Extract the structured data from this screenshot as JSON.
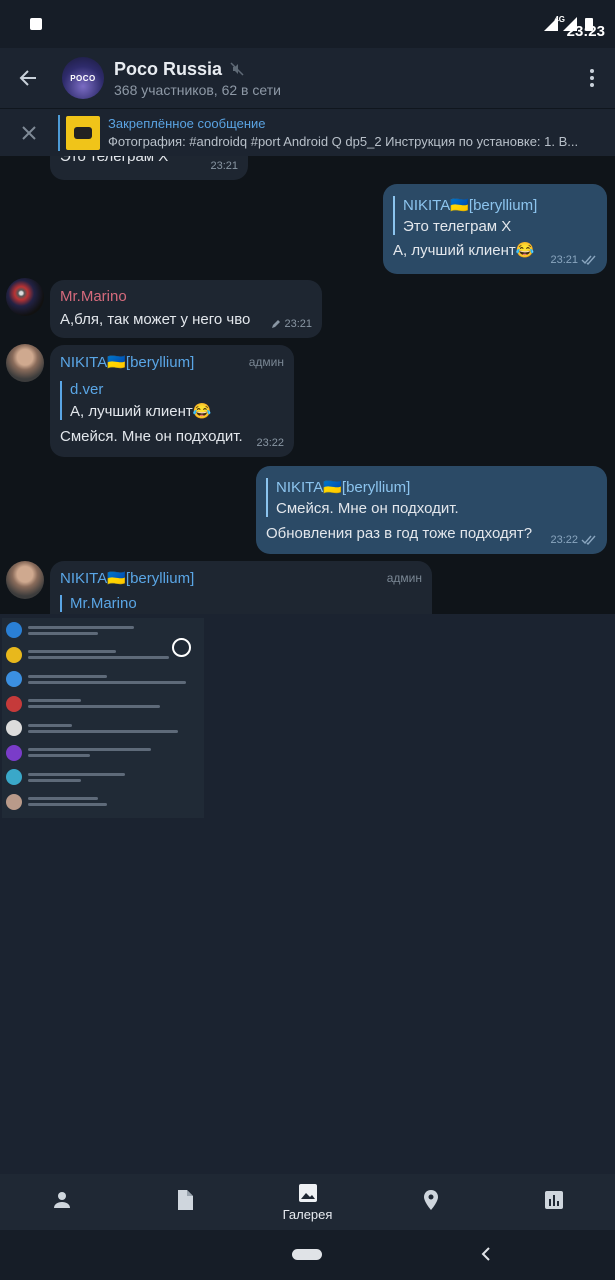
{
  "status_bar": {
    "time": "23:23",
    "network": "4G"
  },
  "header": {
    "title": "Poco Russia",
    "subtitle": "368 участников, 62 в сети",
    "avatar_text": "POCO"
  },
  "pinned": {
    "title": "Закреплённое сообщение",
    "text": "Фотография: #androidq #port Android Q dp5_2  Инструкция по установке: 1. В..."
  },
  "messages": [
    {
      "text": "Это телеграм X",
      "time": "23:21"
    },
    {
      "quote_name": "NIKITA🇺🇦[beryllium]",
      "quote_text": "Это телеграм X",
      "text": "А, лучший клиент😂",
      "time": "23:21"
    },
    {
      "name": "Mr.Marino",
      "text": "А,бля,  так может у него чво",
      "time": "23:21"
    },
    {
      "name": "NIKITA🇺🇦[beryllium]",
      "badge": "админ",
      "quote_name": "d.ver",
      "quote_text": "А, лучший клиент😂",
      "text": "Смейся. Мне он подходит.",
      "time": "23:22"
    },
    {
      "quote_name": "NIKITA🇺🇦[beryllium]",
      "quote_text": "Смейся. Мне он подходит.",
      "text": "Обновления раз в год тоже подходят?",
      "time": "23:22"
    },
    {
      "name": "NIKITA🇺🇦[beryllium]",
      "badge": "админ",
      "quote_name": "Mr.Marino"
    }
  ],
  "attach_tabs": [
    {
      "icon": "contact-icon",
      "label": ""
    },
    {
      "icon": "file-icon",
      "label": ""
    },
    {
      "icon": "gallery-icon",
      "label": "Галерея"
    },
    {
      "icon": "location-icon",
      "label": ""
    },
    {
      "icon": "poll-icon",
      "label": ""
    }
  ],
  "colors": {
    "accent": "#5aa6e6",
    "outgoing_bubble": "#2b4a66",
    "incoming_bubble": "#1e2631"
  }
}
